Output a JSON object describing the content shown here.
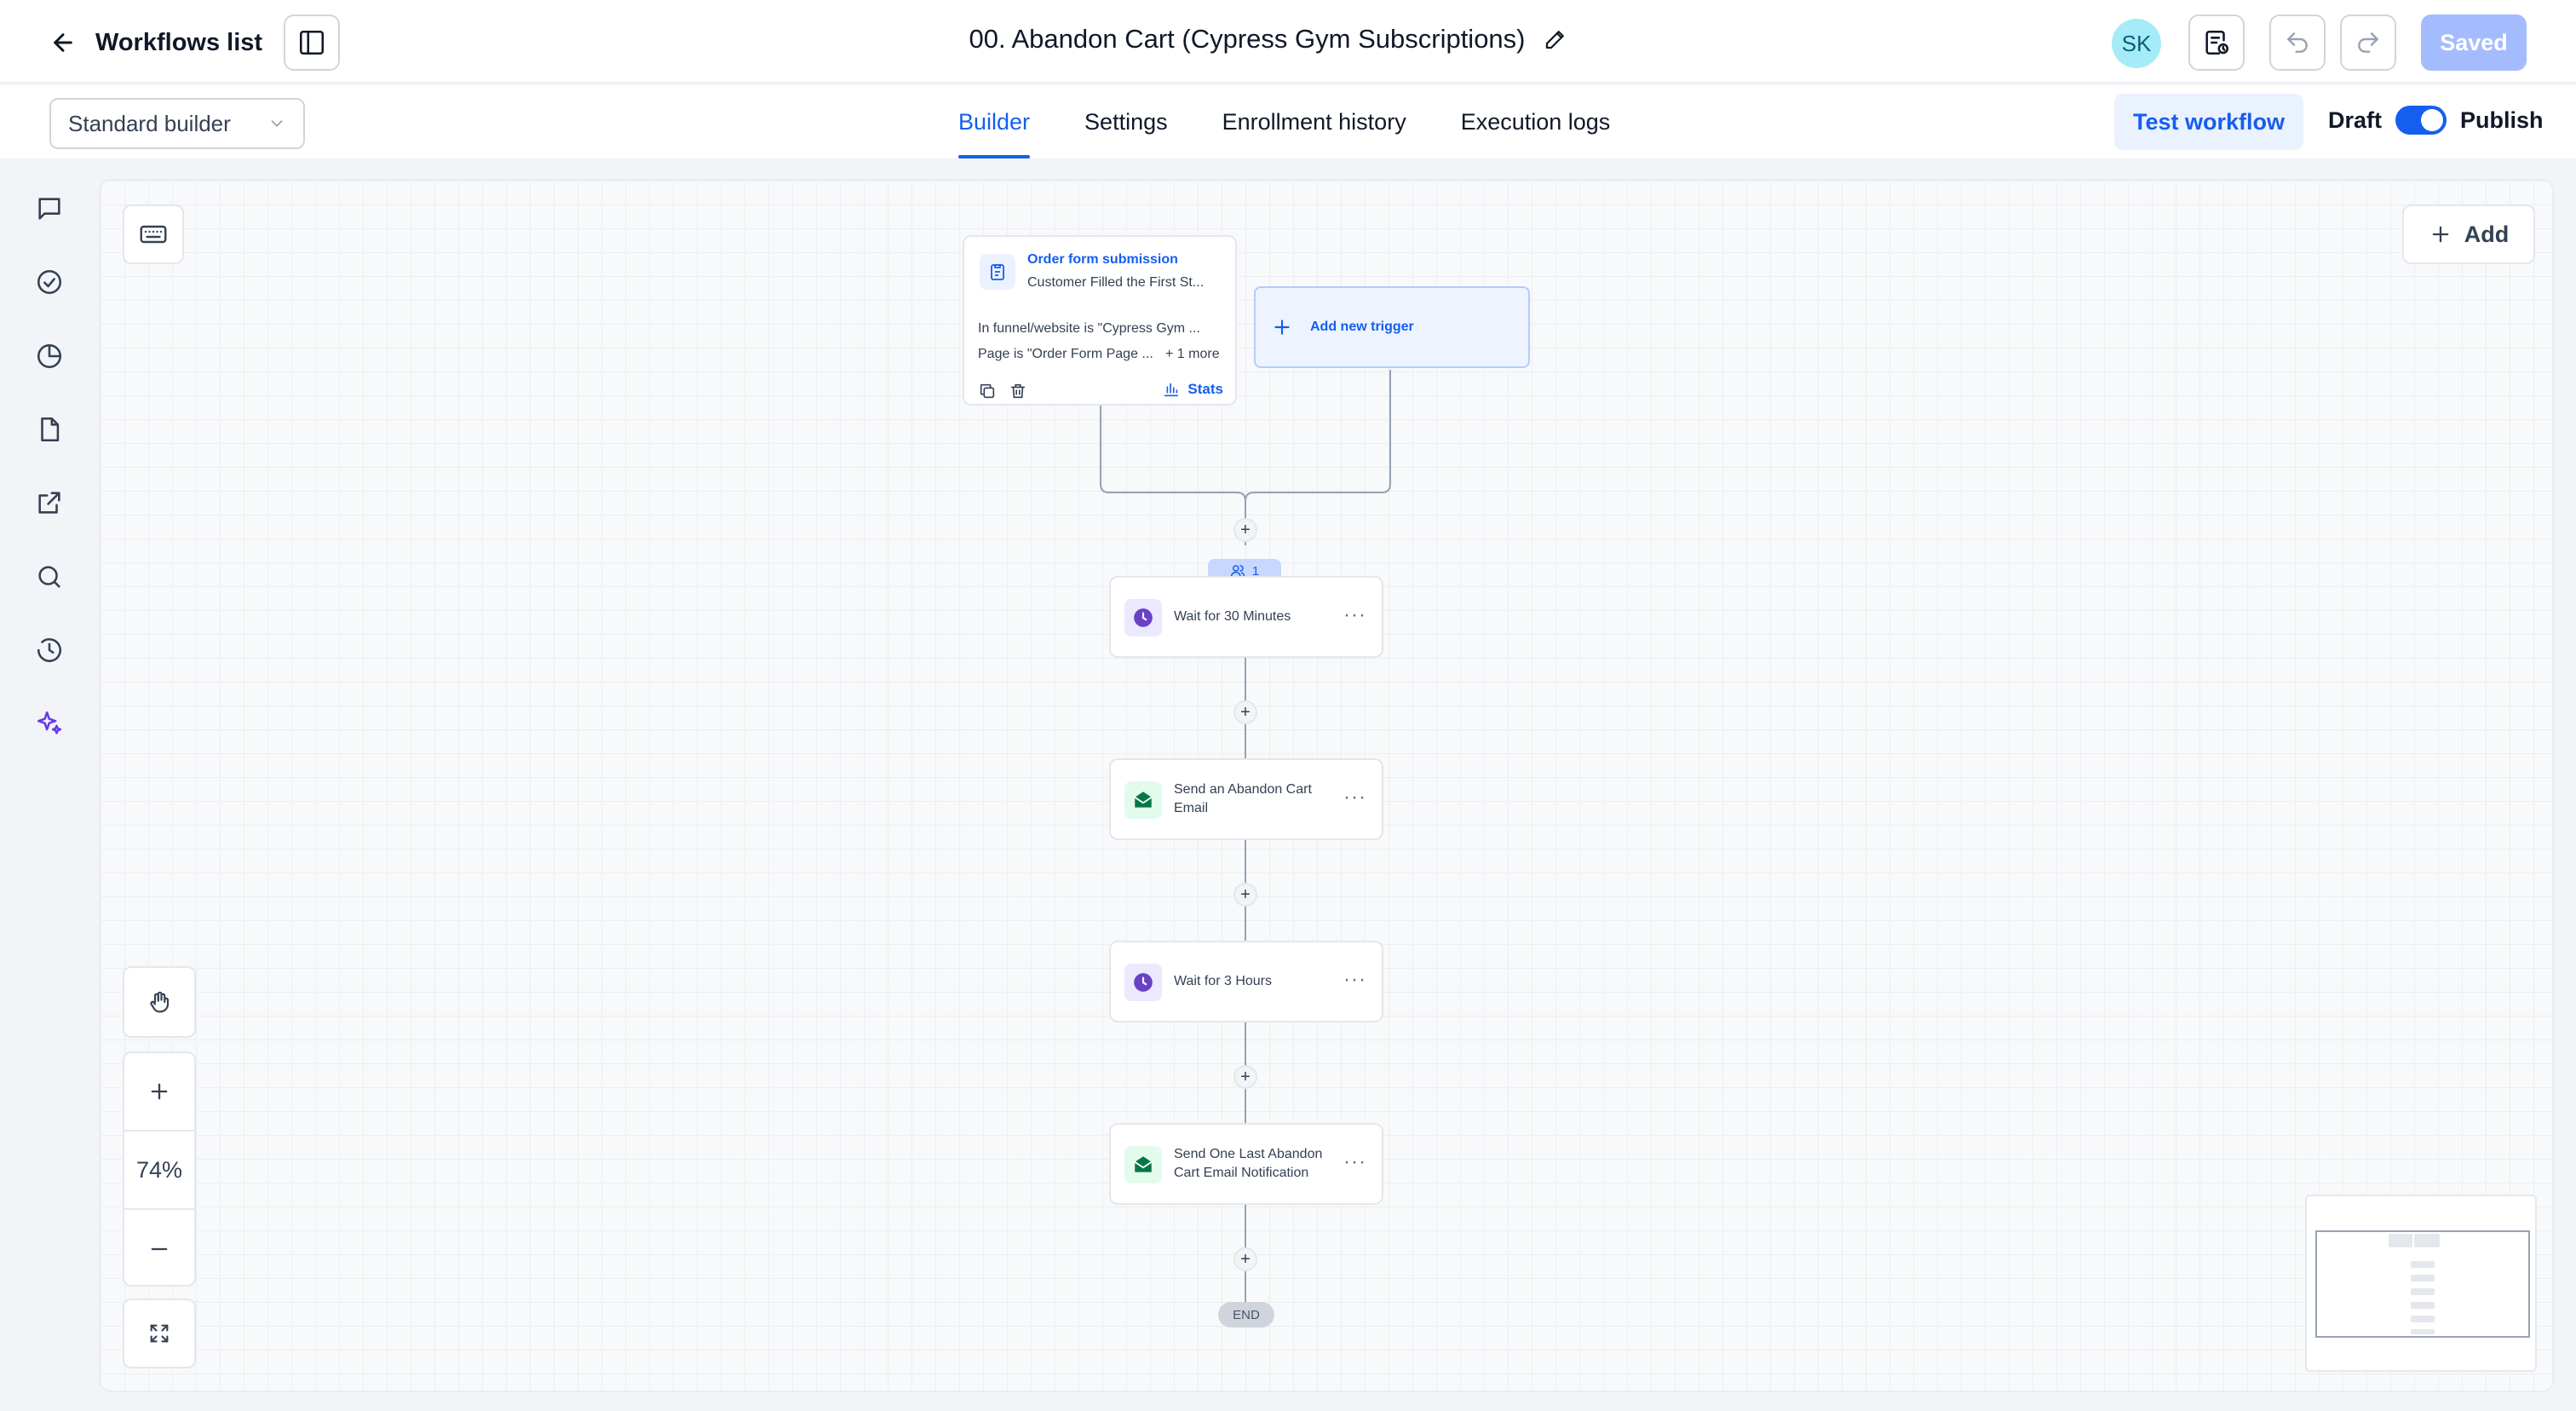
{
  "topbar": {
    "back_label": "Workflows list",
    "workflow_title": "00. Abandon Cart (Cypress Gym Subscriptions)",
    "avatar_initials": "SK",
    "saved_label": "Saved"
  },
  "subbar": {
    "builder_select_value": "Standard builder",
    "tabs": [
      {
        "label": "Builder",
        "active": true
      },
      {
        "label": "Settings",
        "active": false
      },
      {
        "label": "Enrollment history",
        "active": false
      },
      {
        "label": "Execution logs",
        "active": false
      }
    ],
    "test_workflow_label": "Test workflow",
    "draft_label": "Draft",
    "publish_label": "Publish",
    "published": true
  },
  "rail": {
    "icons": [
      "chat-icon",
      "check-circle-icon",
      "pie-chart-icon",
      "file-icon",
      "external-link-icon",
      "search-icon",
      "history-icon",
      "ai-sparkle-icon"
    ]
  },
  "canvas": {
    "add_label": "Add",
    "trigger": {
      "title": "Order form submission",
      "subtitle": "Customer Filled the First St...",
      "condition_1": "In funnel/website is \"Cypress Gym ...",
      "condition_2": "Page is \"Order Form Page ...",
      "more": "+ 1 more",
      "stats_label": "Stats"
    },
    "add_trigger_label": "Add new trigger",
    "enrolled_count": "1",
    "actions": [
      {
        "label": "Wait for 30 Minutes",
        "type": "wait"
      },
      {
        "label": "Send an Abandon Cart Email",
        "type": "email"
      },
      {
        "label": "Wait for 3 Hours",
        "type": "wait"
      },
      {
        "label": "Send One Last Abandon Cart Email Notification",
        "type": "email"
      }
    ],
    "end_label": "END",
    "zoom_percent": "74%"
  },
  "colors": {
    "accent": "#155eef",
    "wait_icon": "#6941c6",
    "email_icon": "#067647",
    "saved_disabled": "#a4bcfd"
  }
}
